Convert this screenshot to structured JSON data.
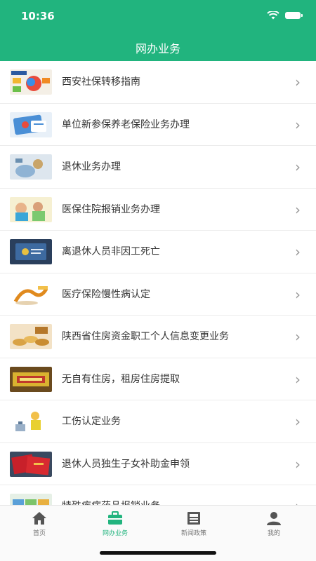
{
  "status": {
    "time": "10:36"
  },
  "header": {
    "title": "网办业务"
  },
  "list": {
    "items": [
      {
        "label": "西安社保转移指南",
        "icon": "social-security-thumb"
      },
      {
        "label": "单位新参保养老保险业务办理",
        "icon": "pension-card-thumb"
      },
      {
        "label": "退休业务办理",
        "icon": "retirement-thumb"
      },
      {
        "label": "医保住院报销业务办理",
        "icon": "hospital-thumb"
      },
      {
        "label": "离退休人员非因工死亡",
        "icon": "certificate-thumb"
      },
      {
        "label": "医疗保险慢性病认定",
        "icon": "chronic-illness-thumb"
      },
      {
        "label": "陕西省住房资金职工个人信息变更业务",
        "icon": "coins-thumb"
      },
      {
        "label": "无自有住房，租房住房提取",
        "icon": "rental-housing-thumb"
      },
      {
        "label": "工伤认定业务",
        "icon": "work-injury-thumb"
      },
      {
        "label": "退休人员独生子女补助金申领",
        "icon": "red-certificate-thumb"
      },
      {
        "label": "特殊疾病药品报销业务",
        "icon": "medicine-thumb"
      }
    ]
  },
  "tabbar": {
    "tabs": [
      {
        "label": "首页",
        "icon": "home-icon",
        "active": false
      },
      {
        "label": "网办业务",
        "icon": "briefcase-icon",
        "active": true
      },
      {
        "label": "新闻政策",
        "icon": "newspaper-icon",
        "active": false
      },
      {
        "label": "我的",
        "icon": "person-icon",
        "active": false
      }
    ]
  },
  "colors": {
    "primary": "#21b47e",
    "tab_inactive": "#777777"
  }
}
